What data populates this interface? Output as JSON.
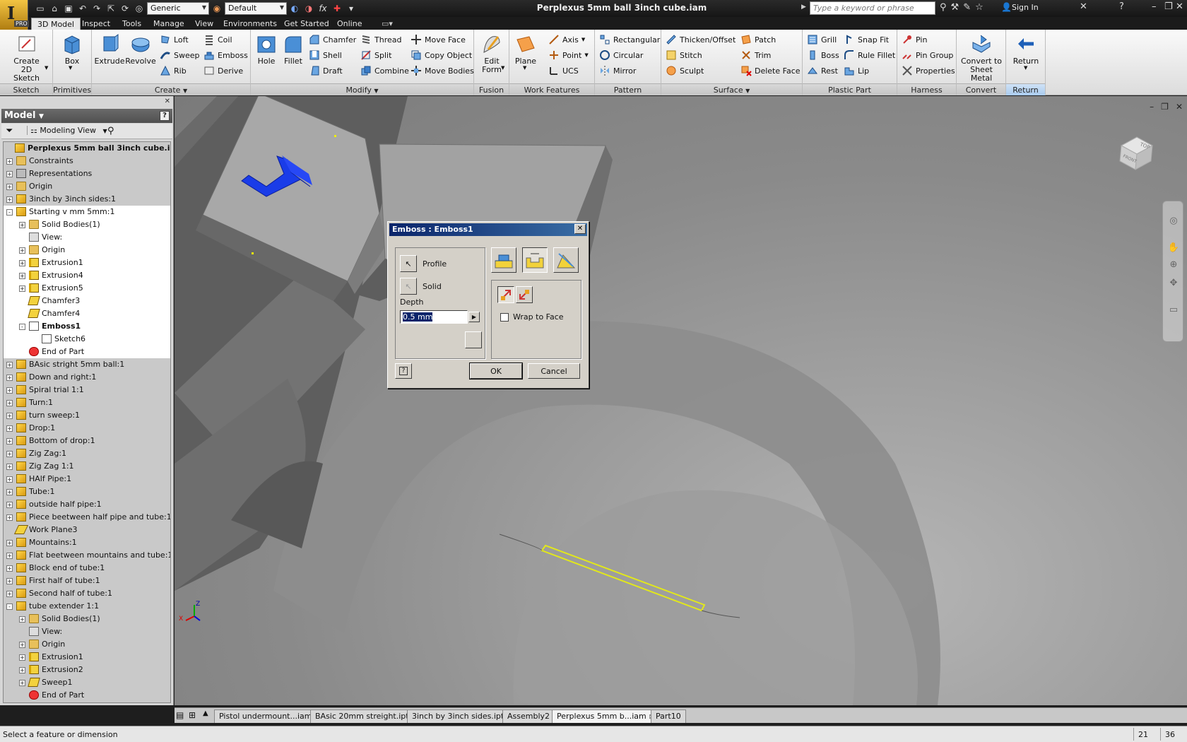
{
  "app": {
    "title": "Perplexus 5mm ball 3inch cube.iam",
    "badge": "PRO"
  },
  "qat": {
    "material": "Generic",
    "appearance": "Default",
    "fx": "fx"
  },
  "search": {
    "placeholder": "Type a keyword or phrase"
  },
  "signin": "Sign In",
  "tabs": [
    "3D Model",
    "Inspect",
    "Tools",
    "Manage",
    "View",
    "Environments",
    "Get Started",
    "Online"
  ],
  "ribbon": {
    "sketch": {
      "title": "Sketch",
      "create": "Create\n2D Sketch"
    },
    "primitives": {
      "title": "Primitives",
      "box": "Box"
    },
    "create": {
      "title": "Create",
      "extrude": "Extrude",
      "revolve": "Revolve",
      "loft": "Loft",
      "sweep": "Sweep",
      "rib": "Rib",
      "coil": "Coil",
      "emboss": "Emboss",
      "derive": "Derive"
    },
    "modify": {
      "title": "Modify",
      "hole": "Hole",
      "fillet": "Fillet",
      "chamfer": "Chamfer",
      "shell": "Shell",
      "draft": "Draft",
      "thread": "Thread",
      "split": "Split",
      "combine": "Combine",
      "moveface": "Move Face",
      "copyobject": "Copy Object",
      "movebodies": "Move Bodies"
    },
    "fusion": {
      "title": "Fusion",
      "editform": "Edit\nForm"
    },
    "workfeatures": {
      "title": "Work Features",
      "plane": "Plane",
      "axis": "Axis",
      "point": "Point",
      "ucs": "UCS"
    },
    "pattern": {
      "title": "Pattern",
      "rectangular": "Rectangular",
      "circular": "Circular",
      "mirror": "Mirror"
    },
    "surface": {
      "title": "Surface",
      "thicken": "Thicken/Offset",
      "stitch": "Stitch",
      "sculpt": "Sculpt",
      "patch": "Patch",
      "trim": "Trim",
      "deleteface": "Delete Face"
    },
    "plastic": {
      "title": "Plastic Part",
      "grill": "Grill",
      "boss": "Boss",
      "rest": "Rest",
      "snapfit": "Snap Fit",
      "rulefillet": "Rule Fillet",
      "lip": "Lip"
    },
    "harness": {
      "title": "Harness",
      "pin": "Pin",
      "pingroup": "Pin Group",
      "properties": "Properties"
    },
    "convert": {
      "title": "Convert",
      "sheetmetal": "Convert to\nSheet Metal"
    },
    "return": {
      "title": "Return",
      "label": "Return"
    }
  },
  "browser": {
    "header": "Model",
    "view": "Modeling View",
    "tree": [
      {
        "label": "Perplexus 5mm ball 3inch cube.iam",
        "indent": 0,
        "exp": "",
        "icon": "asm",
        "bold": true,
        "white": false
      },
      {
        "label": "Constraints",
        "indent": 1,
        "exp": "+",
        "icon": "fld",
        "white": false
      },
      {
        "label": "Representations",
        "indent": 1,
        "exp": "+",
        "icon": "rep",
        "white": false
      },
      {
        "label": "Origin",
        "indent": 1,
        "exp": "+",
        "icon": "fld",
        "white": false
      },
      {
        "label": "3inch by 3inch sides:1",
        "indent": 1,
        "exp": "+",
        "icon": "asm",
        "white": false
      },
      {
        "label": "Starting v mm 5mm:1",
        "indent": 1,
        "exp": "-",
        "icon": "asm",
        "white": true
      },
      {
        "label": "Solid Bodies(1)",
        "indent": 2,
        "exp": "+",
        "icon": "fld",
        "white": true
      },
      {
        "label": "View:",
        "indent": 2,
        "exp": "",
        "icon": "vw",
        "white": true
      },
      {
        "label": "Origin",
        "indent": 2,
        "exp": "+",
        "icon": "fld",
        "white": true
      },
      {
        "label": "Extrusion1",
        "indent": 2,
        "exp": "+",
        "icon": "ext",
        "white": true
      },
      {
        "label": "Extrusion4",
        "indent": 2,
        "exp": "+",
        "icon": "ext",
        "white": true
      },
      {
        "label": "Extrusion5",
        "indent": 2,
        "exp": "+",
        "icon": "ext",
        "white": true
      },
      {
        "label": "Chamfer3",
        "indent": 2,
        "exp": "",
        "icon": "chf",
        "white": true
      },
      {
        "label": "Chamfer4",
        "indent": 2,
        "exp": "",
        "icon": "chf",
        "white": true
      },
      {
        "label": "Emboss1",
        "indent": 2,
        "exp": "-",
        "icon": "sk",
        "bold": true,
        "white": true
      },
      {
        "label": "Sketch6",
        "indent": 3,
        "exp": "",
        "icon": "sk",
        "white": true
      },
      {
        "label": "End of Part",
        "indent": 2,
        "exp": "",
        "icon": "err",
        "white": true
      },
      {
        "label": "BAsic stright 5mm ball:1",
        "indent": 1,
        "exp": "+",
        "icon": "asm",
        "white": false
      },
      {
        "label": "Down and right:1",
        "indent": 1,
        "exp": "+",
        "icon": "asm",
        "white": false
      },
      {
        "label": "Spiral trial 1:1",
        "indent": 1,
        "exp": "+",
        "icon": "asm",
        "white": false
      },
      {
        "label": "Turn:1",
        "indent": 1,
        "exp": "+",
        "icon": "asm",
        "white": false
      },
      {
        "label": "turn sweep:1",
        "indent": 1,
        "exp": "+",
        "icon": "asm",
        "white": false
      },
      {
        "label": "Drop:1",
        "indent": 1,
        "exp": "+",
        "icon": "asm",
        "white": false
      },
      {
        "label": "Bottom of drop:1",
        "indent": 1,
        "exp": "+",
        "icon": "asm",
        "white": false
      },
      {
        "label": "Zig Zag:1",
        "indent": 1,
        "exp": "+",
        "icon": "asm",
        "white": false
      },
      {
        "label": "Zig Zag 1:1",
        "indent": 1,
        "exp": "+",
        "icon": "asm",
        "white": false
      },
      {
        "label": "HAlf Pipe:1",
        "indent": 1,
        "exp": "+",
        "icon": "asm",
        "white": false
      },
      {
        "label": "Tube:1",
        "indent": 1,
        "exp": "+",
        "icon": "asm",
        "white": false
      },
      {
        "label": "outside half pipe:1",
        "indent": 1,
        "exp": "+",
        "icon": "asm",
        "white": false
      },
      {
        "label": "Piece beetween half pipe and tube:1",
        "indent": 1,
        "exp": "+",
        "icon": "asm",
        "white": false
      },
      {
        "label": "Work Plane3",
        "indent": 1,
        "exp": "",
        "icon": "wp",
        "white": false
      },
      {
        "label": "Mountains:1",
        "indent": 1,
        "exp": "+",
        "icon": "asm",
        "white": false
      },
      {
        "label": "Flat beetween mountains and tube:1",
        "indent": 1,
        "exp": "+",
        "icon": "asm",
        "white": false
      },
      {
        "label": "Block end of tube:1",
        "indent": 1,
        "exp": "+",
        "icon": "asm",
        "white": false
      },
      {
        "label": "First half of tube:1",
        "indent": 1,
        "exp": "+",
        "icon": "asm",
        "white": false
      },
      {
        "label": "Second half of tube:1",
        "indent": 1,
        "exp": "+",
        "icon": "asm",
        "white": false
      },
      {
        "label": "tube extender 1:1",
        "indent": 1,
        "exp": "-",
        "icon": "asm",
        "white": false
      },
      {
        "label": "Solid Bodies(1)",
        "indent": 2,
        "exp": "+",
        "icon": "fld",
        "white": false
      },
      {
        "label": "View:",
        "indent": 2,
        "exp": "",
        "icon": "vw",
        "white": false
      },
      {
        "label": "Origin",
        "indent": 2,
        "exp": "+",
        "icon": "fld",
        "white": false
      },
      {
        "label": "Extrusion1",
        "indent": 2,
        "exp": "+",
        "icon": "ext",
        "white": false
      },
      {
        "label": "Extrusion2",
        "indent": 2,
        "exp": "+",
        "icon": "ext",
        "white": false
      },
      {
        "label": "Sweep1",
        "indent": 2,
        "exp": "+",
        "icon": "chf",
        "white": false
      },
      {
        "label": "End of Part",
        "indent": 2,
        "exp": "",
        "icon": "err",
        "white": false
      }
    ]
  },
  "dialog": {
    "title": "Emboss : Emboss1",
    "profile": "Profile",
    "solid": "Solid",
    "depth_label": "Depth",
    "depth_value": "0.5 mm",
    "wrap": "Wrap to Face",
    "wrap_checked": false,
    "ok": "OK",
    "cancel": "Cancel"
  },
  "viewcube": {
    "top": "TOP",
    "front": "FRONT"
  },
  "doctabs": [
    "Pistol undermount...iam",
    "BAsic 20mm streight.ipt",
    "3inch by 3inch sides.ipt",
    "Assembly2",
    "Perplexus 5mm b...iam",
    "Part10"
  ],
  "status": {
    "text": "Select a feature or dimension",
    "c1": "21",
    "c2": "36"
  }
}
